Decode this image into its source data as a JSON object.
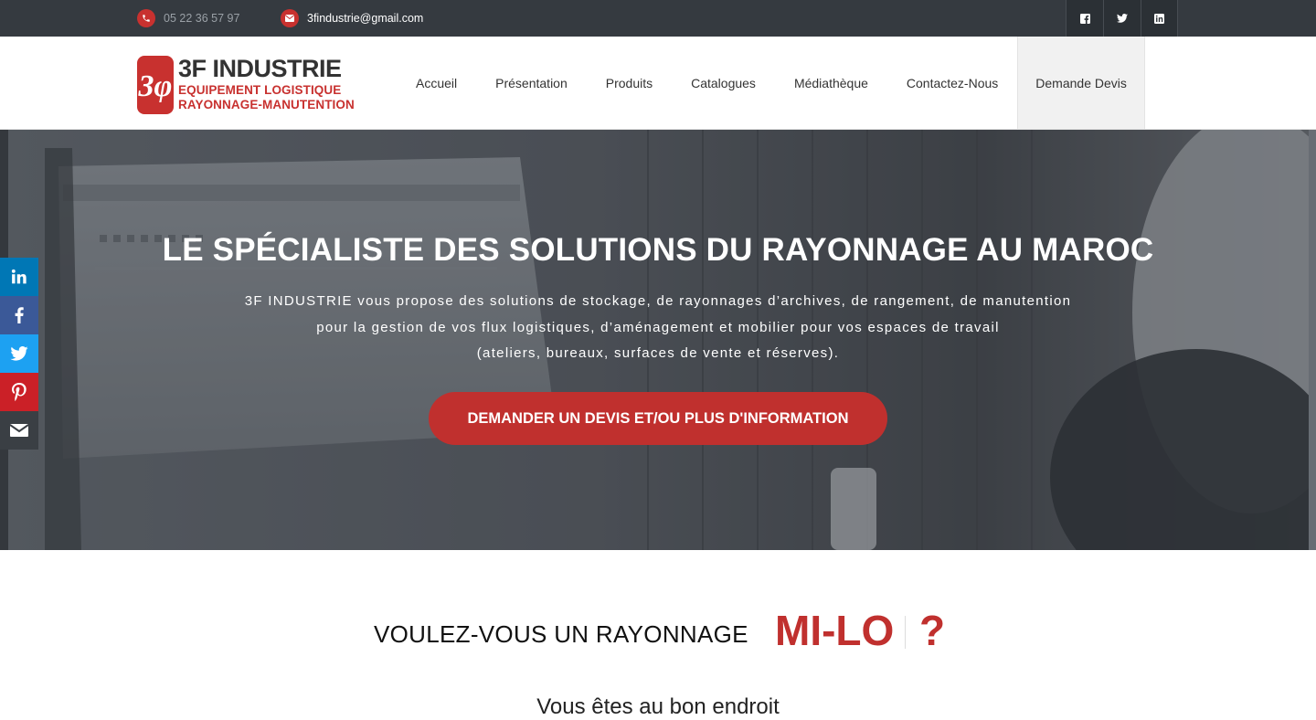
{
  "topbar": {
    "phone": "05 22 36 57 97",
    "email": "3findustrie@gmail.com",
    "social": [
      {
        "name": "facebook-icon"
      },
      {
        "name": "twitter-icon"
      },
      {
        "name": "linkedin-icon"
      }
    ]
  },
  "header": {
    "logo": {
      "mark": "3φ",
      "line1": "3F INDUSTRIE",
      "line2": "EQUIPEMENT LOGISTIQUE",
      "line3": "RAYONNAGE-MANUTENTION"
    },
    "nav": [
      {
        "label": "Accueil"
      },
      {
        "label": "Présentation"
      },
      {
        "label": "Produits"
      },
      {
        "label": "Catalogues"
      },
      {
        "label": "Médiathèque"
      },
      {
        "label": "Contactez-Nous"
      },
      {
        "label": "Demande Devis"
      }
    ]
  },
  "hero": {
    "title": "LE SPÉCIALISTE DES SOLUTIONS DU RAYONNAGE AU MAROC",
    "desc_line1": "3F INDUSTRIE vous propose des solutions de stockage, de rayonnages d’archives, de rangement, de manutention",
    "desc_line2": "pour la gestion de vos flux logistiques, d’aménagement et mobilier pour vos espaces de travail",
    "desc_line3": "(ateliers, bureaux, surfaces de vente et réserves).",
    "cta": "DEMANDER UN DEVIS ET/OU PLUS D'INFORMATION"
  },
  "share": [
    {
      "name": "linkedin-share-icon",
      "color": "#0077b5"
    },
    {
      "name": "facebook-share-icon",
      "color": "#3b5998"
    },
    {
      "name": "twitter-share-icon",
      "color": "#1da1f2"
    },
    {
      "name": "pinterest-share-icon",
      "color": "#cb2027"
    },
    {
      "name": "email-share-icon",
      "color": "#3a3f44"
    }
  ],
  "section": {
    "question": "VOULEZ-VOUS UN RAYONNAGE",
    "highlight": "MI-LO",
    "mark": "?",
    "subtitle": "Vous êtes au bon endroit"
  },
  "colors": {
    "accent": "#c0302e",
    "topbar": "#353a40"
  }
}
